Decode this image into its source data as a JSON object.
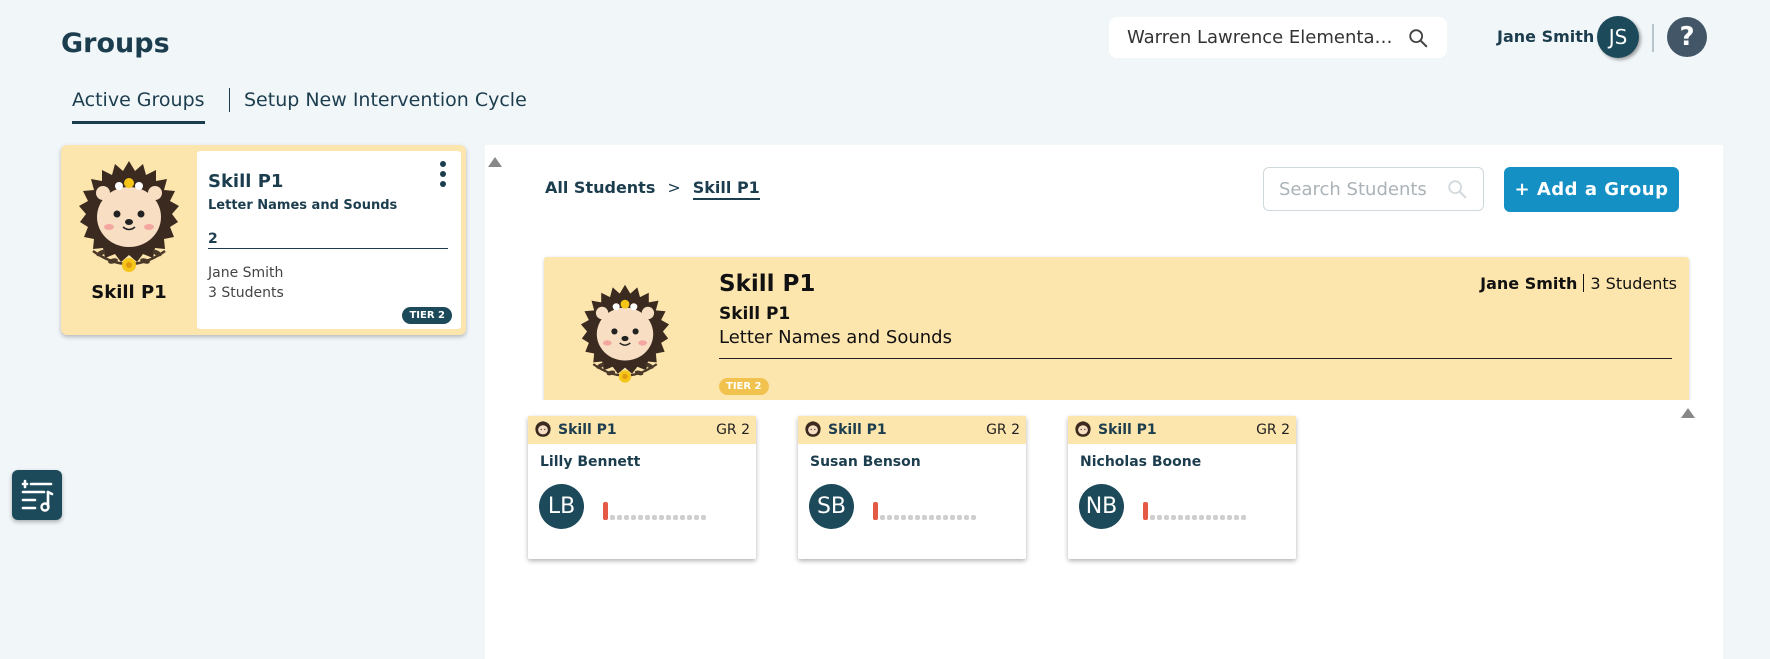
{
  "header": {
    "title": "Groups",
    "school": "Warren Lawrence Elementary School",
    "user_name": "Jane Smith",
    "user_initials": "JS",
    "help_label": "?"
  },
  "tabs": [
    {
      "label": "Active Groups",
      "active": true
    },
    {
      "label": "Setup New Intervention Cycle",
      "active": false
    }
  ],
  "group_card": {
    "label": "Skill P1",
    "title": "Skill P1",
    "subtitle": "Letter Names and Sounds",
    "number": "2",
    "teacher": "Jane Smith",
    "students": "3 Students",
    "tier": "TIER 2"
  },
  "breadcrumb": {
    "root": "All Students",
    "separator": ">",
    "current": "Skill P1"
  },
  "search": {
    "placeholder": "Search Students"
  },
  "add_group_label": "+ Add a Group",
  "detail": {
    "title": "Skill P1",
    "subtitle": "Skill P1",
    "description": "Letter Names and Sounds",
    "teacher": "Jane Smith",
    "students": "3 Students",
    "tier": "TIER 2"
  },
  "student_cards": [
    {
      "group": "Skill P1",
      "grade": "GR 2",
      "name": "Lilly Bennett",
      "initials": "LB",
      "progress": 1,
      "total_steps": 15
    },
    {
      "group": "Skill P1",
      "grade": "GR 2",
      "name": "Susan Benson",
      "initials": "SB",
      "progress": 1,
      "total_steps": 15
    },
    {
      "group": "Skill P1",
      "grade": "GR 2",
      "name": "Nicholas Boone",
      "initials": "NB",
      "progress": 1,
      "total_steps": 15
    }
  ],
  "colors": {
    "primary_dark": "#1c3d4e",
    "accent_blue": "#1590c5",
    "group_yellow": "#fde5ae",
    "tier_yellow": "#f2c24e",
    "progress_red": "#e55a45",
    "background": "#f1f6f9"
  },
  "icons": {
    "search": "search-icon",
    "help": "help-icon",
    "kebab": "kebab-menu-icon",
    "tools": "sliders-music-icon",
    "mascot": "hedgehog-icon"
  }
}
